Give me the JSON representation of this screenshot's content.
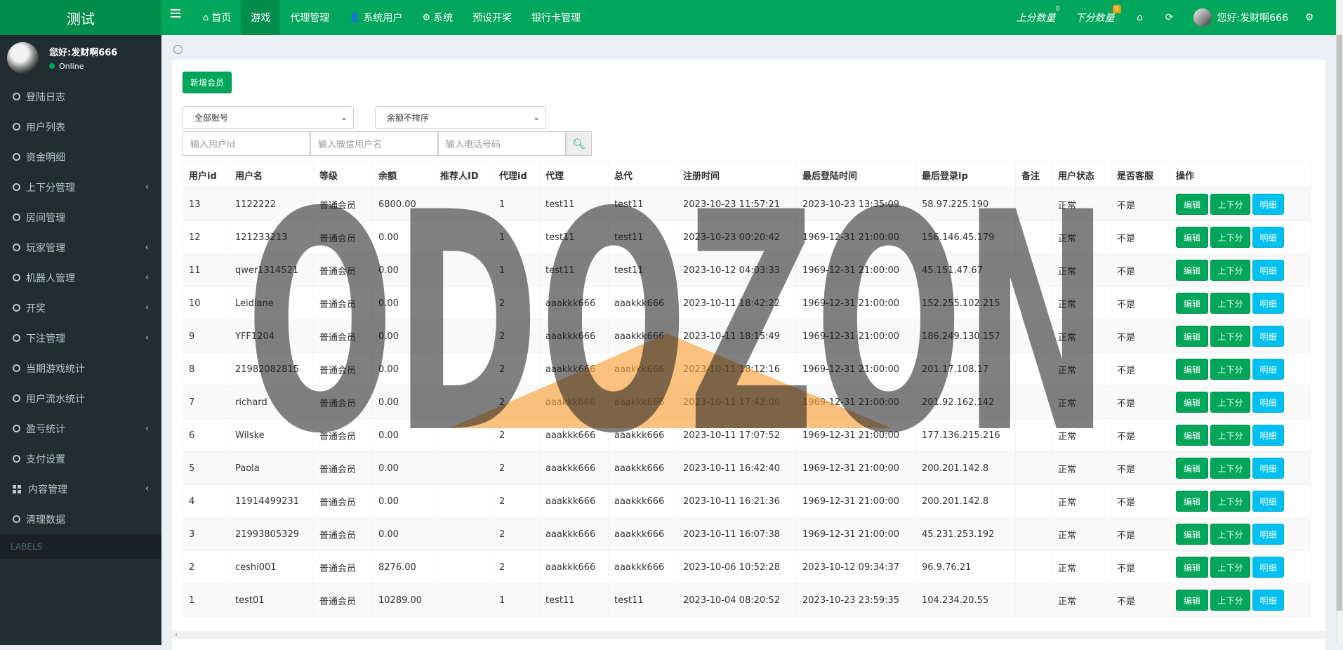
{
  "brand": "测试",
  "topnav": [
    {
      "label": "首页",
      "icon": "home-icon"
    },
    {
      "label": "游戏",
      "active": true
    },
    {
      "label": "代理管理"
    },
    {
      "label": "系统用户",
      "icon": "user-icon"
    },
    {
      "label": "系统",
      "icon": "gear-icon"
    },
    {
      "label": "预设开奖"
    },
    {
      "label": "银行卡管理"
    }
  ],
  "topright": {
    "up_count_label": "上分数量",
    "up_count_badge": "0",
    "down_count_label": "下分数量",
    "down_count_badge": "0",
    "greeting": "您好:发财啊666"
  },
  "user_panel": {
    "name": "您好:发财啊666",
    "status": "Online"
  },
  "sidebar": {
    "items": [
      {
        "label": "登陆日志"
      },
      {
        "label": "用户列表"
      },
      {
        "label": "资金明细"
      },
      {
        "label": "上下分管理",
        "has_children": true
      },
      {
        "label": "房间管理"
      },
      {
        "label": "玩家管理",
        "has_children": true
      },
      {
        "label": "机器人管理",
        "has_children": true
      },
      {
        "label": "开奖",
        "has_children": true
      },
      {
        "label": "下注管理",
        "has_children": true
      },
      {
        "label": "当期游戏统计"
      },
      {
        "label": "用户流水统计"
      },
      {
        "label": "盈亏统计",
        "has_children": true
      },
      {
        "label": "支付设置"
      },
      {
        "label": "内容管理",
        "has_children": true,
        "icon": "grid-icon"
      },
      {
        "label": "清理数据"
      }
    ],
    "labels_header": "LABELS"
  },
  "toolbar": {
    "new_member": "新增会员",
    "account_filter": "全部账号",
    "sort_filter": "余额不排序",
    "uid_placeholder": "输入用户id",
    "wechat_placeholder": "输入微信用户名",
    "phone_placeholder": "输入电话号码"
  },
  "table": {
    "headers": [
      "用户id",
      "用户名",
      "等级",
      "余额",
      "推荐人ID",
      "代理id",
      "代理",
      "总代",
      "注册时间",
      "最后登陆时间",
      "最后登录ip",
      "备注",
      "用户状态",
      "是否客服",
      "操作"
    ],
    "actions": {
      "edit": "编辑",
      "score": "上下分",
      "detail": "明细"
    },
    "rows": [
      [
        "13",
        "1122222",
        "普通会员",
        "6800.00",
        "",
        "1",
        "test11",
        "test11",
        "2023-10-23 11:57:21",
        "2023-10-23 13:35:09",
        "58.97.225.190",
        "",
        "正常",
        "不是"
      ],
      [
        "12",
        "121233213",
        "普通会员",
        "0.00",
        "",
        "1",
        "test11",
        "test11",
        "2023-10-23 00:20:42",
        "1969-12-31 21:00:00",
        "156.146.45.179",
        "",
        "正常",
        "不是"
      ],
      [
        "11",
        "qwer1314521",
        "普通会员",
        "0.00",
        "",
        "1",
        "test11",
        "test11",
        "2023-10-12 04:03:33",
        "1969-12-31 21:00:00",
        "45.151.47.67",
        "",
        "正常",
        "不是"
      ],
      [
        "10",
        "Leidiane",
        "普通会员",
        "0.00",
        "",
        "2",
        "aaakkk666",
        "aaakkk666",
        "2023-10-11 18:42:22",
        "1969-12-31 21:00:00",
        "152.255.102.215",
        "",
        "正常",
        "不是"
      ],
      [
        "9",
        "YFF1204",
        "普通会员",
        "0.00",
        "",
        "2",
        "aaakkk666",
        "aaakkk666",
        "2023-10-11 18:15:49",
        "1969-12-31 21:00:00",
        "186.249.130.157",
        "",
        "正常",
        "不是"
      ],
      [
        "8",
        "21982082815",
        "普通会员",
        "0.00",
        "",
        "2",
        "aaakkk666",
        "aaakkk666",
        "2023-10-11 18:12:16",
        "1969-12-31 21:00:00",
        "201.17.108.17",
        "",
        "正常",
        "不是"
      ],
      [
        "7",
        "richard",
        "普通会员",
        "0.00",
        "",
        "2",
        "aaakkk666",
        "aaakkk666",
        "2023-10-11 17:42:06",
        "1969-12-31 21:00:00",
        "201.92.162.142",
        "",
        "正常",
        "不是"
      ],
      [
        "6",
        "Wilske",
        "普通会员",
        "0.00",
        "",
        "2",
        "aaakkk666",
        "aaakkk666",
        "2023-10-11 17:07:52",
        "1969-12-31 21:00:00",
        "177.136.215.216",
        "",
        "正常",
        "不是"
      ],
      [
        "5",
        "Paola",
        "普通会员",
        "0.00",
        "",
        "2",
        "aaakkk666",
        "aaakkk666",
        "2023-10-11 16:42:40",
        "1969-12-31 21:00:00",
        "200.201.142.8",
        "",
        "正常",
        "不是"
      ],
      [
        "4",
        "11914499231",
        "普通会员",
        "0.00",
        "",
        "2",
        "aaakkk666",
        "aaakkk666",
        "2023-10-11 16:21:36",
        "1969-12-31 21:00:00",
        "200.201.142.8",
        "",
        "正常",
        "不是"
      ],
      [
        "3",
        "21993805329",
        "普通会员",
        "0.00",
        "",
        "2",
        "aaakkk666",
        "aaakkk666",
        "2023-10-11 16:07:38",
        "1969-12-31 21:00:00",
        "45.231.253.192",
        "",
        "正常",
        "不是"
      ],
      [
        "2",
        "ceshi001",
        "普通会员",
        "8276.00",
        "",
        "2",
        "aaakkk666",
        "aaakkk666",
        "2023-10-06 10:52:28",
        "2023-10-12 09:34:37",
        "96.9.76.21",
        "",
        "正常",
        "不是"
      ],
      [
        "1",
        "test01",
        "普通会员",
        "10289.00",
        "",
        "1",
        "test11",
        "test11",
        "2023-10-04 08:20:52",
        "2023-10-23 23:59:35",
        "104.234.20.55",
        "",
        "正常",
        "不是"
      ]
    ]
  },
  "watermark": "ODOZON",
  "colors": {
    "primary": "#00a65a",
    "primary_dark": "#008d4c",
    "info": "#00c0ef",
    "sidebar": "#222d32"
  }
}
